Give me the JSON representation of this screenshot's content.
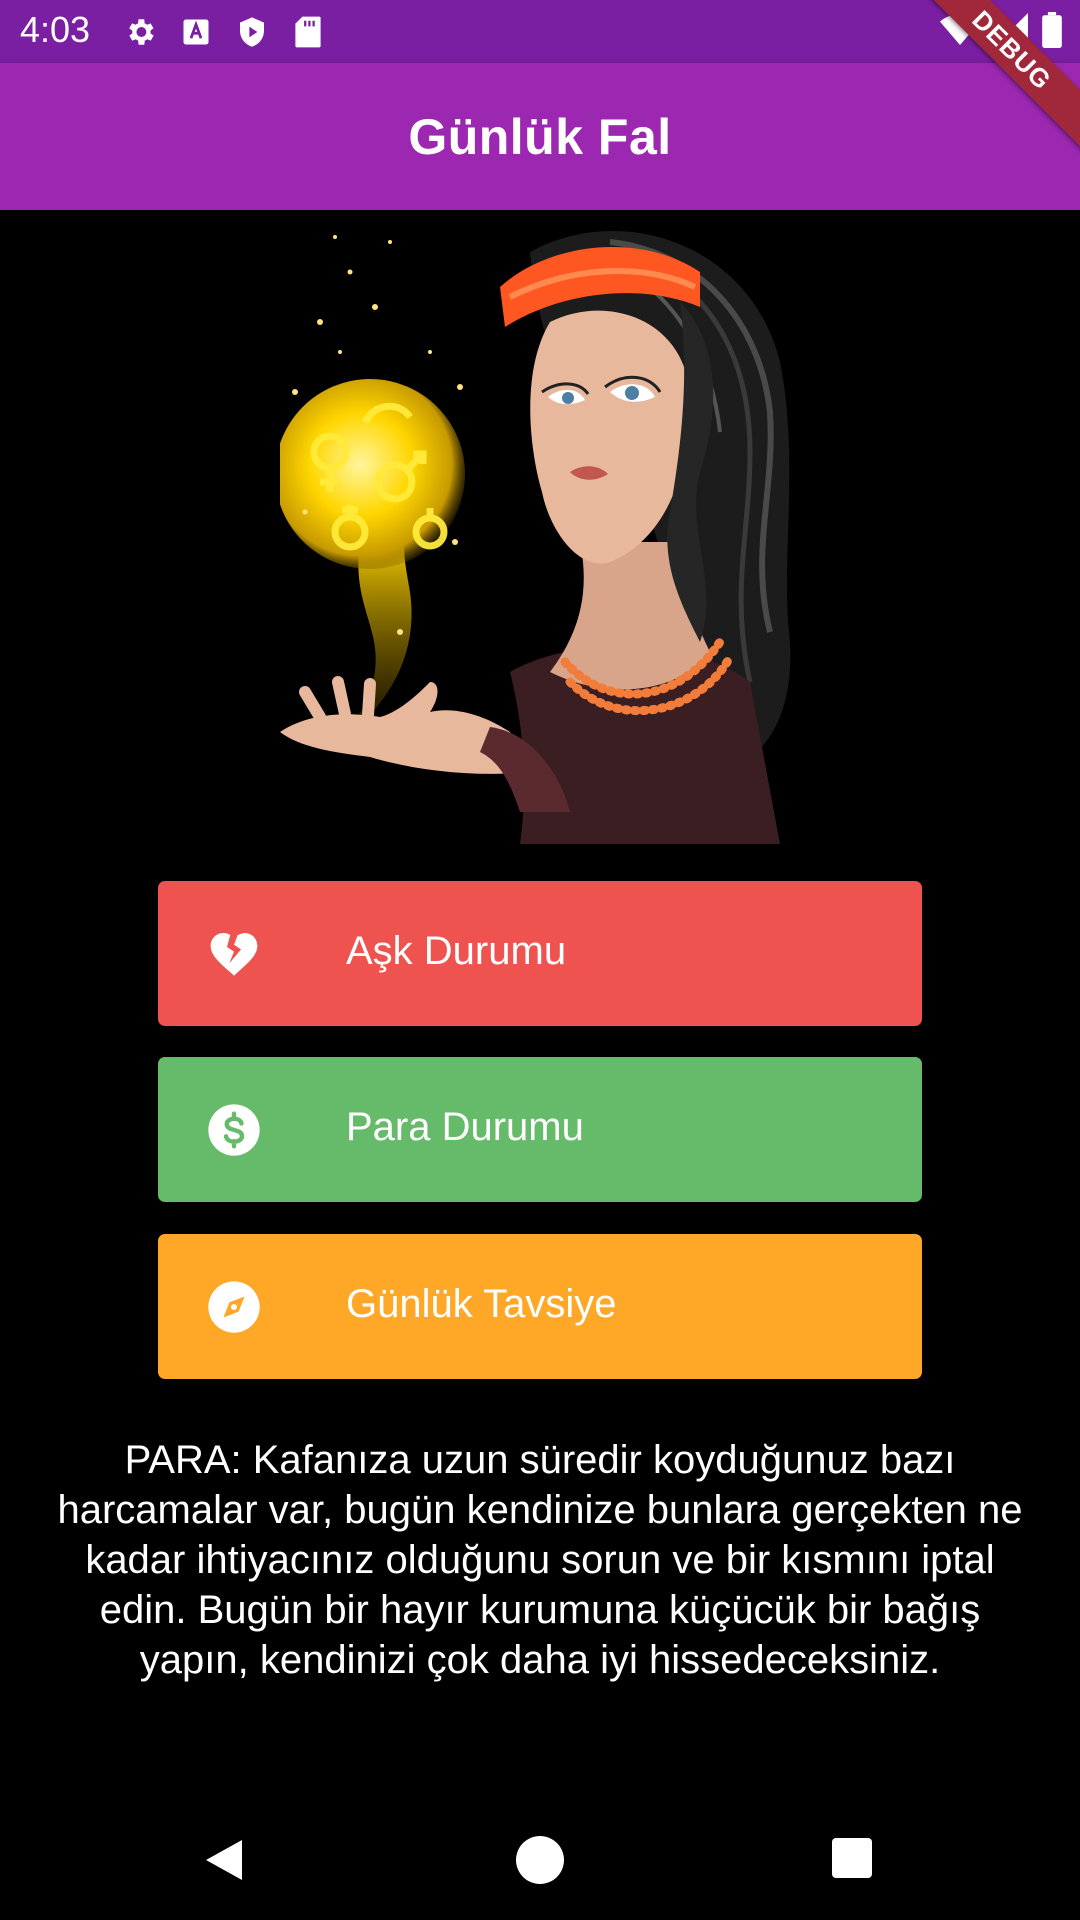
{
  "status_bar": {
    "time": "4:03",
    "left_icons": [
      "gear-icon",
      "text-a-icon",
      "shield-play-icon",
      "sd-card-icon"
    ],
    "right_icons": [
      "wifi-icon",
      "signal-icon",
      "battery-icon"
    ]
  },
  "debug_banner": "DEBUG",
  "app_bar": {
    "title": "Günlük Fal"
  },
  "hero": {
    "image": "fortune-teller-illustration"
  },
  "buttons": [
    {
      "label": "Aşk Durumu",
      "icon": "broken-heart-icon",
      "color": "#ef5350"
    },
    {
      "label": "Para Durumu",
      "icon": "dollar-circle-icon",
      "color": "#66bb6a"
    },
    {
      "label": "Günlük Tavsiye",
      "icon": "compass-icon",
      "color": "#ffa726"
    }
  ],
  "fortune": {
    "text": "PARA: Kafanıza uzun süredir koyduğunuz bazı harcamalar var, bugün kendinize bunlara gerçekten ne kadar ihtiyacınız olduğunu sorun ve bir kısmını iptal edin. Bugün bir hayır kurumuna küçücük bir bağış yapın, kendinizi çok daha iyi hissedeceksiniz."
  },
  "nav_bar": {
    "buttons": [
      "back-icon",
      "home-icon",
      "recents-icon"
    ]
  },
  "colors": {
    "status_bar": "#7b1fa2",
    "app_bar": "#9c27b0",
    "background": "#000000"
  }
}
